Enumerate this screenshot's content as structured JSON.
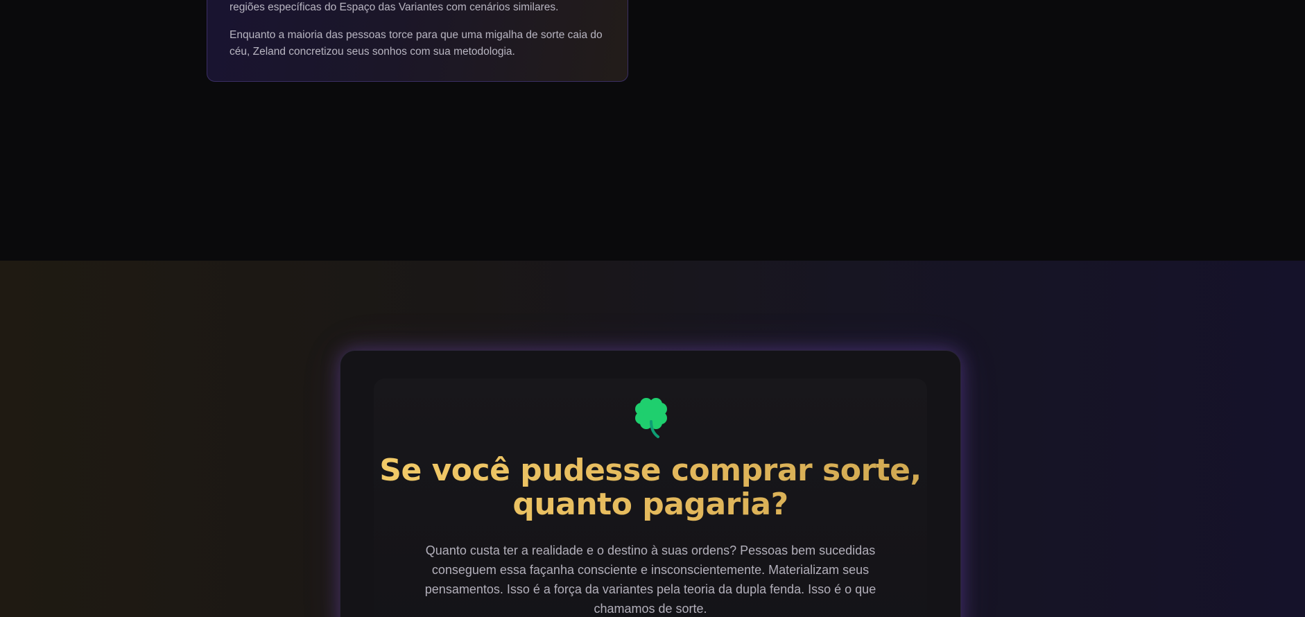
{
  "top_card": {
    "line_partial": "regiões específicas do Espaço das Variantes com cenários similares.",
    "paragraph": "Enquanto a maioria das pessoas torce para que uma migalha de sorte caia do céu, Zeland concretizou seus sonhos com sua metodologia."
  },
  "luck_section": {
    "icon": "four-leaf-clover-icon",
    "title_line1": "Se você pudesse comprar sorte,",
    "title_line2": "quanto pagaria?",
    "text": "Quanto custa ter a realidade e o destino à suas ordens? Pessoas bem sucedidas conseguem essa façanha consciente e insconscientemente. Materializam seus pensamentos. Isso é a força da variantes pela teoria da dupla fenda. Isso é o que chamamos de sorte."
  },
  "colors": {
    "background": "#0a0a0c",
    "gold": "#f4cd6a",
    "clover_green": "#1fcf6e",
    "card_glow": "#8c5ae6"
  }
}
